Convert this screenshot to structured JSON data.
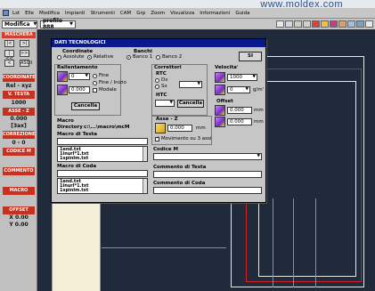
{
  "banner": {
    "url": "www.moldex.com"
  },
  "menu": [
    "Lst",
    "Elle",
    "Modifica",
    "Impianti",
    "Strumenti",
    "CAM",
    "Grp",
    "Zoom",
    "Visualizza",
    "Informazioni",
    "Guida"
  ],
  "toolbar": {
    "mode": "Modifica",
    "profile": "profilo 888"
  },
  "left_panel": {
    "header1": "MASCHERA",
    "buttons_row1": [
      "|<",
      ">|"
    ],
    "buttons_row2": [
      "|<<",
      ">>|"
    ],
    "buttons_row3": [
      "<",
      "ASCII"
    ],
    "coordinate_label": "COORDINATE",
    "coordinate_value": "Rel - xyz",
    "velocita_label": "V. TESTA",
    "velocita_value": "1000",
    "asse_z_label": "ASSE - Z",
    "asse_z_value1": "0.000",
    "asse_z_value2": "[3ax]",
    "correzione_label": "CORREZIONE",
    "correzione_value": "0 - 0",
    "codice_label": "CODICE M",
    "commento_label": "COMMENTO",
    "macro_label": "MACRO",
    "offset_label": "OFFSET",
    "offset_x": "X 0.00",
    "offset_y": "Y 0.00"
  },
  "dialog": {
    "title": "DATI TECNOLOGICI",
    "ok_label": "SI",
    "coordinate": {
      "title": "Coordinate",
      "options": [
        "Assolute",
        "Relative"
      ],
      "selected": "Relative"
    },
    "banchi": {
      "title": "Banchi",
      "options": [
        "Banco 1",
        "Banco 2"
      ],
      "selected": "Banco 1"
    },
    "rallentamento": {
      "title": "Rallentamento",
      "combo_value": "0",
      "field_value": "0.000",
      "radio_options": [
        "Fine",
        "Fine / Inizio"
      ],
      "checkbox": "Modale",
      "cancel_label": "Cancella"
    },
    "correttori": {
      "title": "Correttori",
      "rtc_label": "RTC",
      "rtc_options": [
        "Dx",
        "Sx"
      ],
      "htc_label": "HTC",
      "cancel_label": "Cancella"
    },
    "velocita": {
      "title": "Velocita'",
      "value1": "1000",
      "value2": "0",
      "unit": "g/m'"
    },
    "offset": {
      "title": "Offset",
      "x": "0.000",
      "y": "0.000",
      "unit": "mm"
    },
    "asse_z": {
      "title": "Asse - Z",
      "value": "0.000",
      "unit": "mm",
      "checkbox": "Movimento su 3 assi"
    },
    "macro": {
      "title": "Macro",
      "directory_label": "Directory",
      "directory_value": "c:\\...\\macro\\mcM",
      "testa_label": "Macro di Testa",
      "coda_label": "Macro di Coda",
      "files": [
        "1end.txt",
        "1inurl*1.txt",
        "1spinIm.txt"
      ]
    },
    "codice_m": {
      "title": "Codice M"
    },
    "commento_testa": {
      "title": "Commento di Testa"
    },
    "commento_coda": {
      "title": "Commento di Coda"
    }
  }
}
